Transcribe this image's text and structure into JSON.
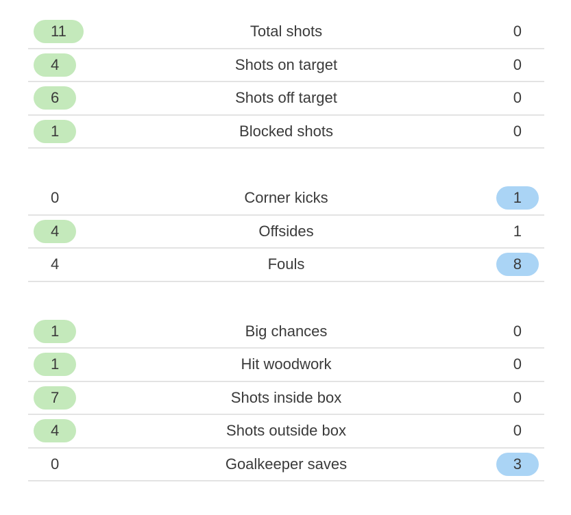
{
  "colors": {
    "home_highlight": "#c4e9bb",
    "away_highlight": "#aad4f5",
    "divider": "#e3e3e3"
  },
  "groups": [
    {
      "rows": [
        {
          "label": "Total shots",
          "home": "11",
          "away": "0",
          "leader": "home"
        },
        {
          "label": "Shots on target",
          "home": "4",
          "away": "0",
          "leader": "home"
        },
        {
          "label": "Shots off target",
          "home": "6",
          "away": "0",
          "leader": "home"
        },
        {
          "label": "Blocked shots",
          "home": "1",
          "away": "0",
          "leader": "home"
        }
      ]
    },
    {
      "rows": [
        {
          "label": "Corner kicks",
          "home": "0",
          "away": "1",
          "leader": "away"
        },
        {
          "label": "Offsides",
          "home": "4",
          "away": "1",
          "leader": "home"
        },
        {
          "label": "Fouls",
          "home": "4",
          "away": "8",
          "leader": "away"
        }
      ]
    },
    {
      "rows": [
        {
          "label": "Big chances",
          "home": "1",
          "away": "0",
          "leader": "home"
        },
        {
          "label": "Hit woodwork",
          "home": "1",
          "away": "0",
          "leader": "home"
        },
        {
          "label": "Shots inside box",
          "home": "7",
          "away": "0",
          "leader": "home"
        },
        {
          "label": "Shots outside box",
          "home": "4",
          "away": "0",
          "leader": "home"
        },
        {
          "label": "Goalkeeper saves",
          "home": "0",
          "away": "3",
          "leader": "away"
        }
      ]
    }
  ]
}
